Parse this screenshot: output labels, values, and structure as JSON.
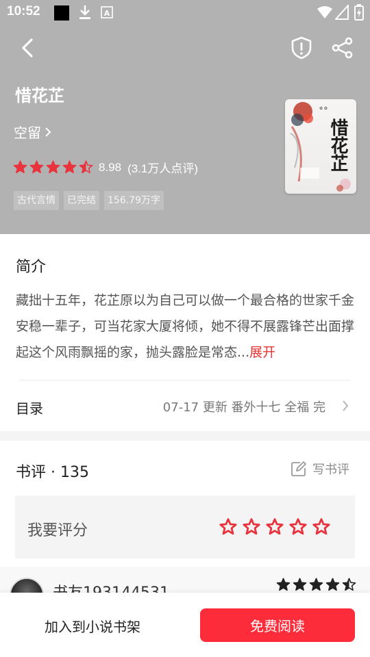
{
  "status_bar": {
    "time": "10:52",
    "icons": [
      "black-square-notification-icon",
      "download-icon",
      "a-icon",
      "wifi-icon",
      "signal-icon",
      "battery-charging-icon"
    ]
  },
  "toolbar": {
    "back_icon": "chevron-left-icon",
    "report_icon": "shield-exclamation-icon",
    "share_icon": "share-icon"
  },
  "book": {
    "title": "惜花芷",
    "author": "空留",
    "rating_score": "8.98",
    "rating_count": "(3.1万人点评)",
    "rating_stars": 4.5,
    "tags": [
      "古代言情",
      "已完结",
      "156.79万字"
    ],
    "cover_text": "惜花芷"
  },
  "intro": {
    "heading": "简介",
    "text": "藏拙十五年，花芷原以为自己可以做一个最合格的世家千金安稳一辈子，可当花家大厦将倾，她不得不展露锋芒出面撑起这个风雨飘摇的家，抛头露脸是常态...",
    "expand_label": "展开"
  },
  "toc": {
    "label": "目录",
    "update_info": "07-17  更新  番外十七 全福 完"
  },
  "reviews": {
    "heading": "书评 · 135",
    "write_label": "写书评",
    "rate_label": "我要评分",
    "rate_stars": 5,
    "items": [
      {
        "user": "书友193144531",
        "stars": 4.5
      }
    ]
  },
  "bottom_bar": {
    "add_shelf_label": "加入到小说书架",
    "read_label": "免费阅读"
  },
  "colors": {
    "header_bg": "#b2b2b2",
    "accent_red": "#fd2c3a",
    "star_red": "#e8333d"
  }
}
